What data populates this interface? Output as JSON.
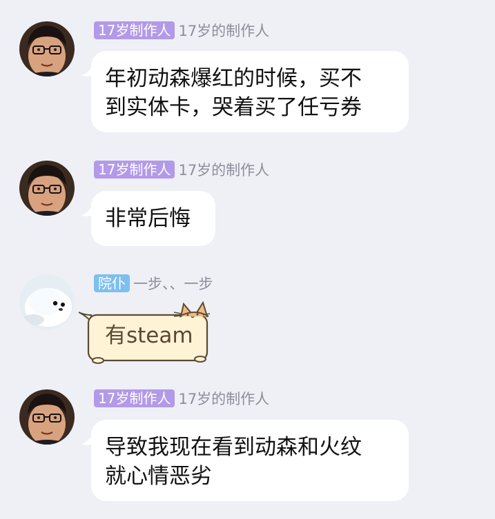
{
  "messages": [
    {
      "badge": "17岁制作人",
      "badge_color": "#b39ae8",
      "nickname": "17岁的制作人",
      "text_lines": [
        "年初动森爆红的时候，买不",
        "到实体卡，哭着买了任亏券"
      ]
    },
    {
      "badge": "17岁制作人",
      "badge_color": "#b39ae8",
      "nickname": "17岁的制作人",
      "text_lines": [
        "非常后悔"
      ]
    },
    {
      "badge": "院仆",
      "badge_color": "#7fbfee",
      "nickname": "一步、、一步",
      "text_lines": [
        "有steam"
      ],
      "bubble_style": "cat-sticker"
    },
    {
      "badge": "17岁制作人",
      "badge_color": "#b39ae8",
      "nickname": "17岁的制作人",
      "text_lines": [
        "导致我现在看到动森和火纹",
        "就心情恶劣"
      ]
    }
  ],
  "avatars": {
    "producer": "person-with-glasses-avatar",
    "seal": "baby-seal-avatar"
  }
}
